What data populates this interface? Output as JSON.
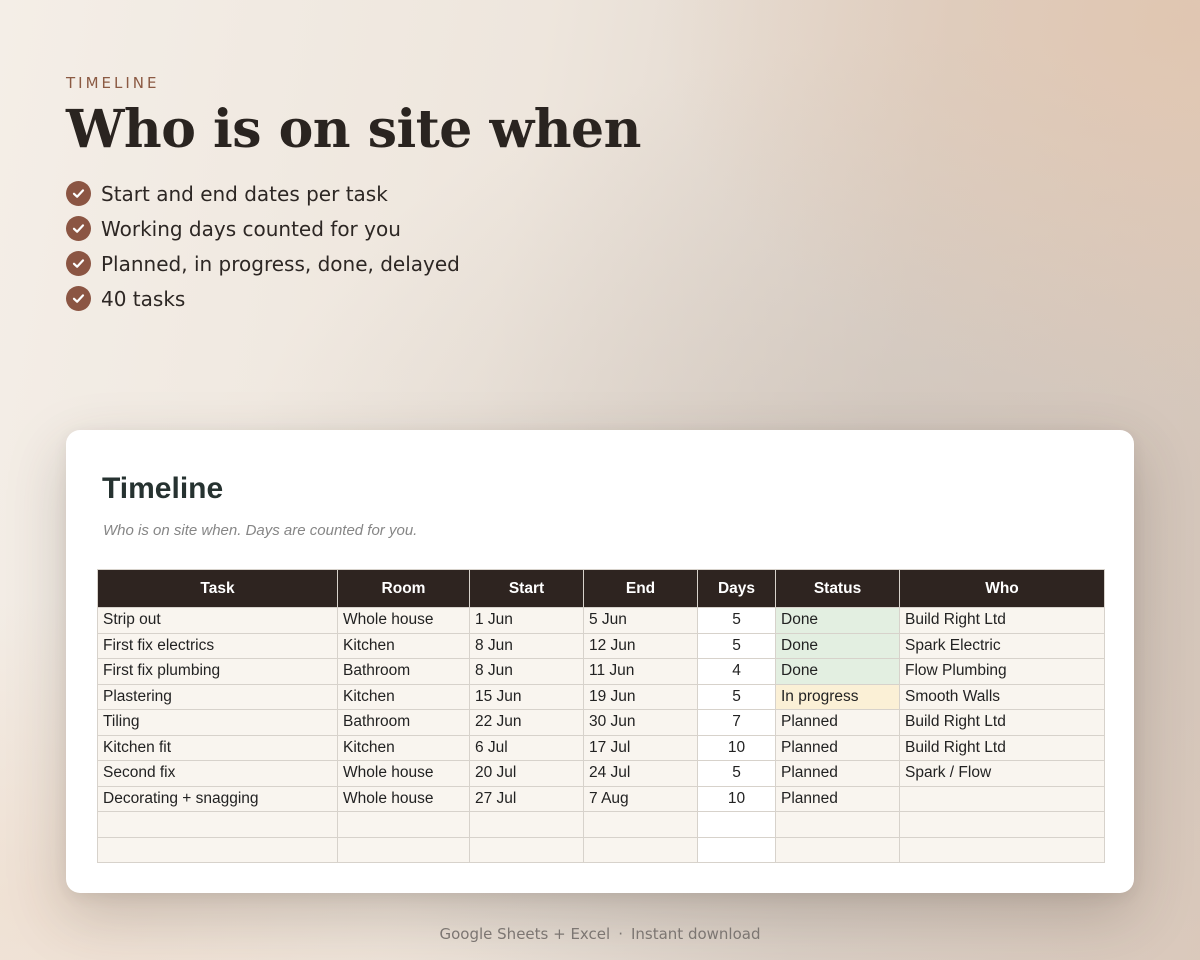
{
  "hero": {
    "eyebrow": "TIMELINE",
    "headline": "Who is on site when",
    "features": [
      "Start and end dates per task",
      "Working days counted for you",
      "Planned, in progress, done, delayed",
      "40 tasks"
    ],
    "check_icon": "check-circle-icon",
    "accent_color": "#8b5543"
  },
  "sheet": {
    "title": "Timeline",
    "subtitle": "Who is on site when. Days are counted for you.",
    "columns": [
      "Task",
      "Room",
      "Start",
      "End",
      "Days",
      "Status",
      "Who"
    ],
    "header_color": "#2e2420",
    "status_colors": {
      "Done": "#e3efe1",
      "In progress": "#fbf0d6",
      "Planned": "#f9f5ef"
    },
    "rows": [
      [
        "Strip out",
        "Whole house",
        "1 Jun",
        "5 Jun",
        "5",
        "Done",
        "Build Right Ltd"
      ],
      [
        "First fix electrics",
        "Kitchen",
        "8 Jun",
        "12 Jun",
        "5",
        "Done",
        "Spark Electric"
      ],
      [
        "First fix plumbing",
        "Bathroom",
        "8 Jun",
        "11 Jun",
        "4",
        "Done",
        "Flow Plumbing"
      ],
      [
        "Plastering",
        "Kitchen",
        "15 Jun",
        "19 Jun",
        "5",
        "In progress",
        "Smooth Walls"
      ],
      [
        "Tiling",
        "Bathroom",
        "22 Jun",
        "30 Jun",
        "7",
        "Planned",
        "Build Right Ltd"
      ],
      [
        "Kitchen fit",
        "Kitchen",
        "6 Jul",
        "17 Jul",
        "10",
        "Planned",
        "Build Right Ltd"
      ],
      [
        "Second fix",
        "Whole house",
        "20 Jul",
        "24 Jul",
        "5",
        "Planned",
        "Spark / Flow"
      ],
      [
        "Decorating + snagging",
        "Whole house",
        "27 Jul",
        "7 Aug",
        "10",
        "Planned",
        ""
      ],
      [
        "",
        "",
        "",
        "",
        "",
        "",
        ""
      ],
      [
        "",
        "",
        "",
        "",
        "",
        "",
        ""
      ]
    ]
  },
  "footer": {
    "platforms": "Google Sheets + Excel",
    "separator": "·",
    "delivery": "Instant download"
  }
}
